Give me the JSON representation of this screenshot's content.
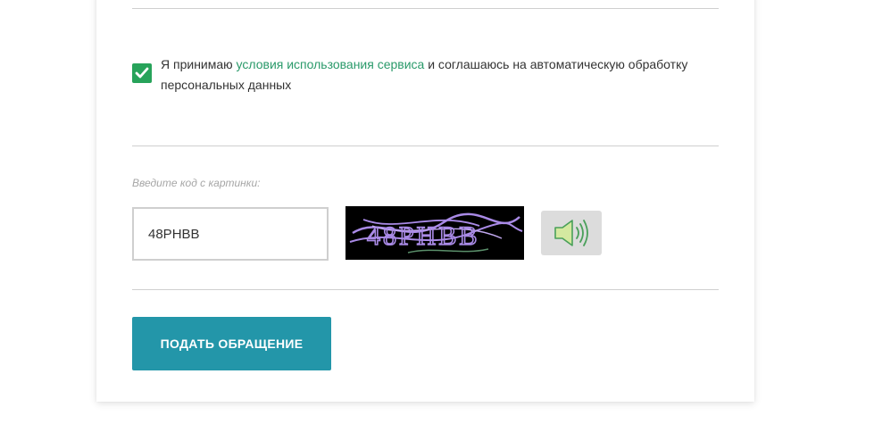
{
  "consent": {
    "checked": true,
    "text_before": "Я принимаю ",
    "link_text": "условия использования сервиса",
    "text_after": " и соглашаюсь на автоматическую обработку персональных данных"
  },
  "captcha": {
    "label": "Введите код с картинки:",
    "input_value": "48PHBB",
    "image_icon": "captcha-image",
    "audio_icon": "speaker-icon"
  },
  "submit": {
    "label": "ПОДАТЬ ОБРАЩЕНИЕ"
  },
  "colors": {
    "accent_green": "#27a35a",
    "link_green": "#2a9a6a",
    "button_teal": "#2396a9",
    "captcha_text": "#a98ae6"
  }
}
